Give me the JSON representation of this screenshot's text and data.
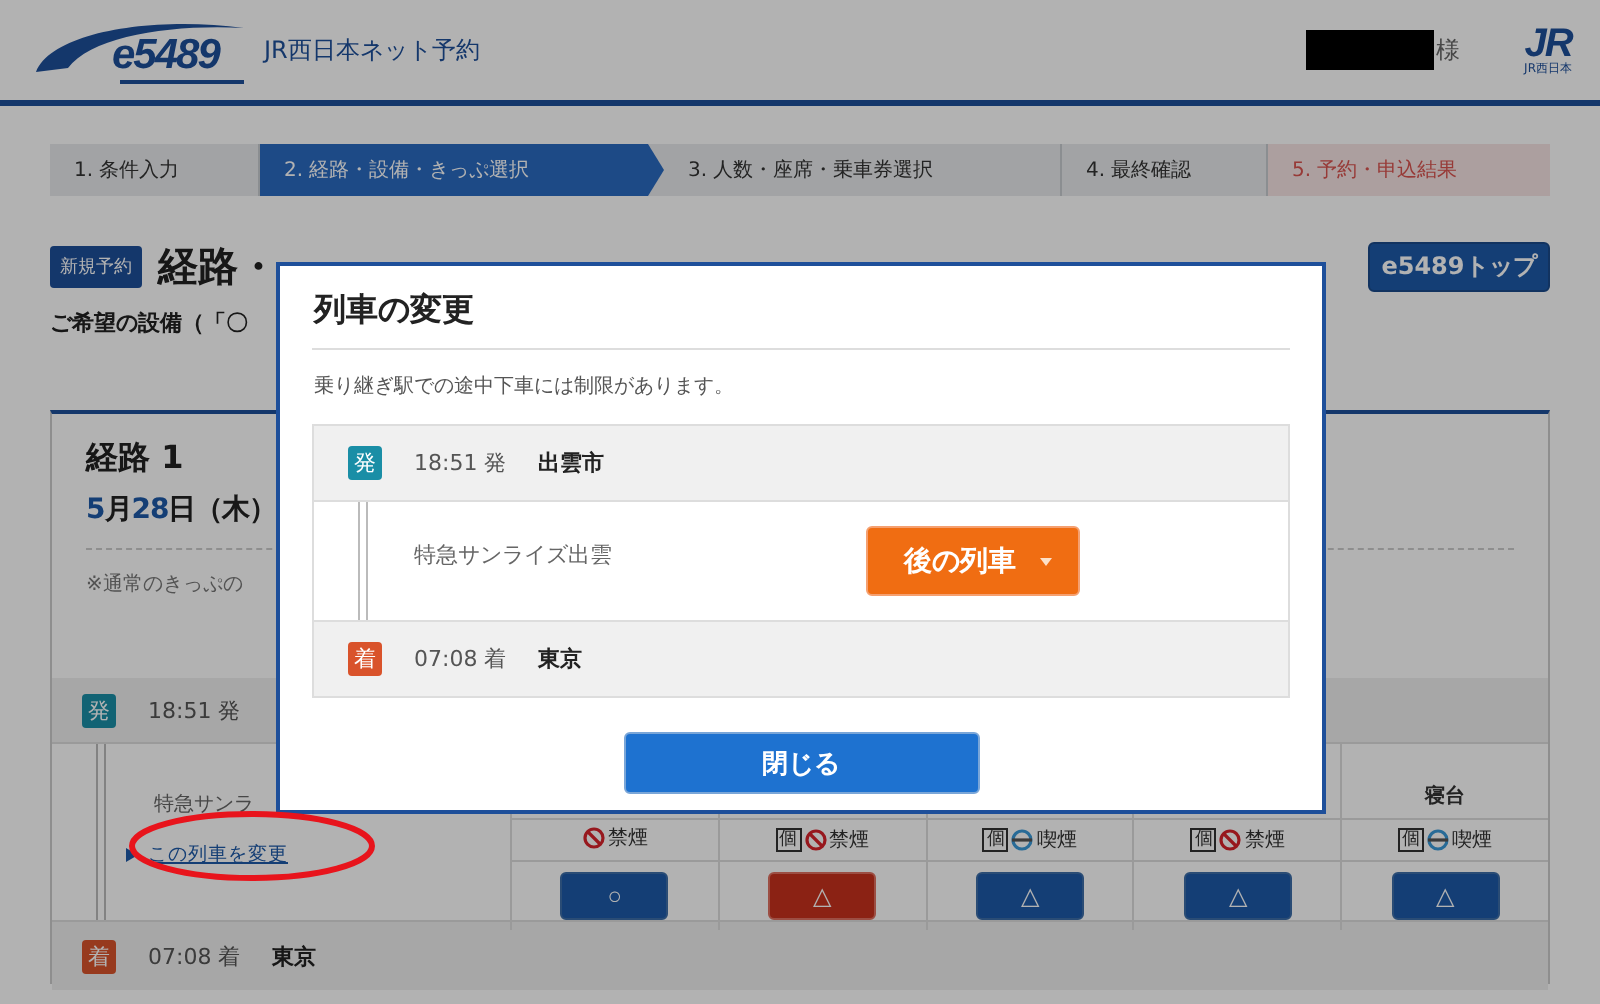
{
  "header": {
    "logo": "e5489",
    "site_name": "JR西日本ネット予約",
    "honorific": "様",
    "corp_logo": "JR",
    "corp_logo_caption": "JR西日本"
  },
  "steps": [
    {
      "label": "1. 条件入力",
      "kind": "step",
      "selected": false
    },
    {
      "label": "2. 経路・設備・きっぷ選択",
      "kind": "step",
      "selected": true
    },
    {
      "label": "3. 人数・座席・乗車券選択",
      "kind": "step",
      "selected": false
    },
    {
      "label": "4. 最終確認",
      "kind": "step",
      "selected": false
    },
    {
      "label": "5. 予約・申込結果",
      "kind": "result",
      "selected": false
    }
  ],
  "page_title": {
    "badge": "新規予約",
    "title": "経路・",
    "top_button": "e5489トップ"
  },
  "facility_note": "ご希望の設備（「〇",
  "route": {
    "title": "経路 1",
    "date": "5月28日（木）",
    "note": "※通常のきっぷの",
    "departure": {
      "badge": "発",
      "time": "18:51 発"
    },
    "train": {
      "name": "特急サンラ",
      "change_link": "この列車を変更"
    },
    "seat_header": "寝台",
    "seats": [
      {
        "smoking": false,
        "label": "禁煙",
        "mark": "○",
        "selected": false
      },
      {
        "private_mark": "個",
        "smoking": false,
        "label": "禁煙",
        "mark": "△",
        "selected": true
      },
      {
        "private_mark": "個",
        "smoking": true,
        "label": "喫煙",
        "mark": "△",
        "selected": false
      },
      {
        "private_mark": "個",
        "smoking": false,
        "label": "禁煙",
        "mark": "△",
        "selected": false
      },
      {
        "private_mark": "個",
        "smoking": true,
        "label": "喫煙",
        "mark": "△",
        "selected": false
      }
    ],
    "arrival": {
      "badge": "着",
      "time": "07:08 着",
      "station": "東京"
    }
  },
  "annotation": {
    "kind": "ellipse"
  },
  "dialog": {
    "title": "列車の変更",
    "note": "乗り継ぎ駅での途中下車には制限があります。",
    "departure": {
      "badge": "発",
      "time": "18:51 発",
      "station": "出雲市"
    },
    "train": {
      "name": "特急サンライズ出雲",
      "change_button": "後の列車"
    },
    "arrival": {
      "badge": "着",
      "time": "07:08 着",
      "station": "東京"
    },
    "close_button": "閉じる"
  }
}
